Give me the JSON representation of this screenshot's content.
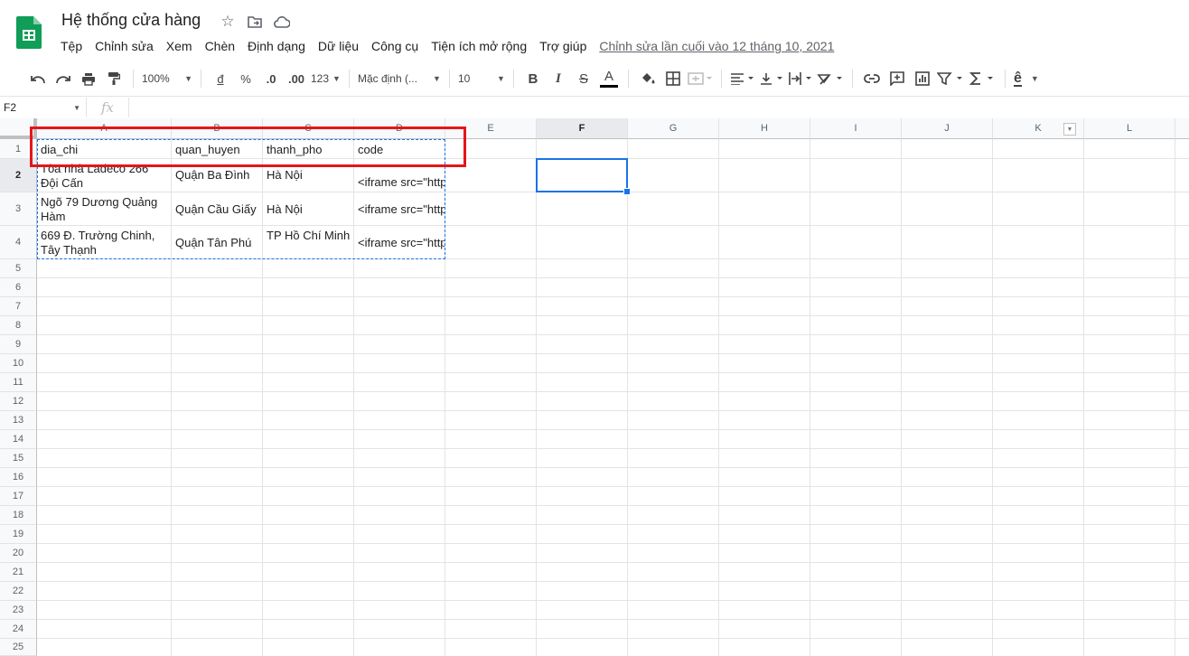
{
  "app": {
    "title": "Hệ thống cửa hàng",
    "menus": [
      "Tệp",
      "Chỉnh sửa",
      "Xem",
      "Chèn",
      "Định dạng",
      "Dữ liệu",
      "Công cụ",
      "Tiện ích mở rộng",
      "Trợ giúp"
    ],
    "last_edit": "Chỉnh sửa lần cuối vào 12 tháng 10, 2021"
  },
  "toolbar": {
    "zoom": "100%",
    "currency": "đ",
    "percent": "%",
    "decrease_decimal": ".0",
    "increase_decimal": ".00",
    "more_formats": "123",
    "font": "Mặc định (...",
    "font_size": "10",
    "bold": "B",
    "italic": "I",
    "strike": "S",
    "text_color": "A",
    "input_tool": "ê"
  },
  "formula_bar": {
    "name_box": "F2",
    "fx": "fx",
    "value": ""
  },
  "columns": [
    "A",
    "B",
    "C",
    "D",
    "E",
    "F",
    "G",
    "H",
    "I",
    "J",
    "K",
    "L"
  ],
  "rows": [
    "1",
    "2",
    "3",
    "4",
    "5",
    "6",
    "7",
    "8",
    "9",
    "10",
    "11",
    "12",
    "13",
    "14",
    "15",
    "16",
    "17",
    "18",
    "19",
    "20",
    "21",
    "22",
    "23",
    "24",
    "25"
  ],
  "cells": {
    "A1": "dia_chi",
    "B1": "quan_huyen",
    "C1": "thanh_pho",
    "D1": "code",
    "A2": "Tòa nhà Ladeco 266 Đội Cấn",
    "B2": "Quận Ba Đình",
    "C2": "Hà Nội",
    "D2": "<iframe src=\"https://",
    "A3": "Ngõ 79 Dương Quảng Hàm",
    "B3": "Quận Cầu Giấy",
    "C3": "Hà Nội",
    "D3": "<iframe src=\"https://",
    "A4": "669 Đ. Trường Chinh, Tây Thạnh",
    "B4": "Quận Tân Phú",
    "C4": "TP Hồ Chí Minh",
    "D4": "<iframe src=\"https://"
  },
  "selected_cell": "F2",
  "colors": {
    "selection": "#1a73e8",
    "annotation": "#e3161b",
    "sheets_green": "#0f9d58"
  }
}
